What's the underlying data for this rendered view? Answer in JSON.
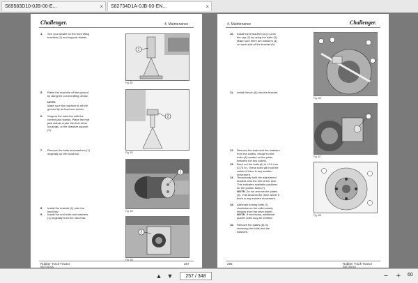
{
  "tabs": [
    {
      "title": "S69583D10-0JB-00-E...",
      "close": "×"
    },
    {
      "title": "S82734D1A-0JB-00-EN...",
      "close": "×"
    }
  ],
  "left_page": {
    "logo": "Challenger.",
    "section": "4. Maintenance",
    "steps": [
      {
        "num": "4.",
        "text": "See your dealer for the front lifting brackets (1) and support stands."
      },
      {
        "num": "5.",
        "text": "Raise the machine off the ground by using the correct lifting device."
      },
      {
        "num": "6.",
        "text": "Support the machine with the correct jack stands. Place the rear jack stands under the final driver housings, or the drawbar support (2)."
      },
      {
        "num": "7.",
        "text": "Remove the bolts and washers (1) originally on the hand bar."
      },
      {
        "num": "8.",
        "text": "Install the bracket (2) onto the hand bar."
      },
      {
        "num": "9.",
        "text": "Install the end bolts and washers (1) originally from the hand bar."
      }
    ],
    "note_label": "NOTE:",
    "note_text": "Make sure the machine is off the ground by at least one inches",
    "figures": [
      "Fig. 82",
      "Fig. 83",
      "Fig. 84",
      "Fig. 85"
    ],
    "callouts": [
      "1",
      "2",
      "1",
      "2"
    ],
    "footer_title": "Rubber Track Tractor",
    "footer_code": "S82734D1A",
    "page_num": "257"
  },
  "right_page": {
    "logo": "Challenger.",
    "section": "4. Maintenance",
    "steps": [
      {
        "num": "10.",
        "text": "Install the threaded rod (1) onto the cap (2) by using the bolts (3). Make sure there are washers (4) on each side of the bracket (5)."
      },
      {
        "num": "11.",
        "text": "Install the pin (6) into the bracket."
      },
      {
        "num": "12.",
        "text": "Remove the bolts and the washers from the collets, except for the bolts (4) located on the joints between the two collets."
      },
      {
        "num": "13.",
        "text": "Back out the bolts (6) to 19.0 mm (0.75 in). These bolts will hold the collets if there is any sudden movement."
      },
      {
        "num": "14.",
        "text": "Temporarily hold the adjustment bracket onto the end of the axle. This indicates available positions for the pusher bolts (7)."
      },
      {
        "num": "15.",
        "text": "Alternate turning bolts (7) clockwise so the collet slowly retracts from the drive wheel."
      },
      {
        "num": "16.",
        "text": "Remove the plates (8) by removing the bolts and the washers."
      }
    ],
    "note1_label": "NOTE:",
    "note1_text": "Do not remove the plates (8). This secures the drive wheel if there is any sudden movement.",
    "note2_label": "NOTE:",
    "note2_text": "If necessary, additional pusher bolts may be needed.",
    "figures": [
      "Fig. 86",
      "Fig. 87",
      "Fig. 88"
    ],
    "footer_title": "Rubber Track Tractor",
    "footer_code": "S82734D1A",
    "page_num": "258"
  },
  "toolbar": {
    "page_indicator": "257 / 348",
    "zoom": "60",
    "icons": [
      "chevron-up-icon",
      "chevron-down-icon",
      "zoom-out-icon",
      "zoom-in-icon"
    ]
  },
  "colors": {
    "viewer_bg": "#7a7a7a",
    "page_bg": "#ffffff",
    "toolbar_bg": "#f0f0f0"
  }
}
